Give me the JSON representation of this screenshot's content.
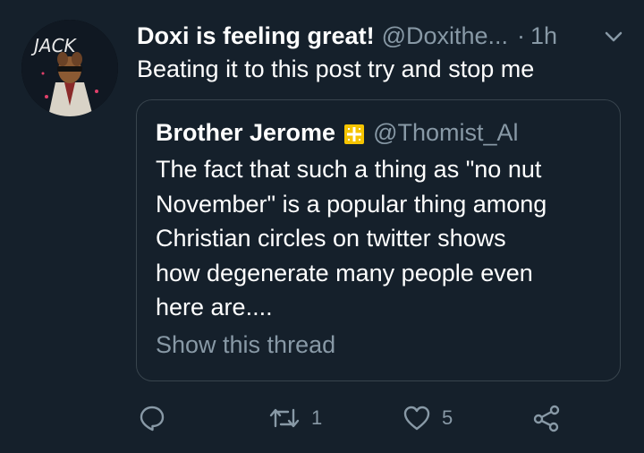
{
  "tweet": {
    "display_name": "Doxi is feeling great!",
    "handle": "@Doxithe...",
    "separator": "·",
    "time": "1h",
    "text": "Beating it to this post try and stop me",
    "avatar_text": "JACK"
  },
  "quoted_tweet": {
    "display_name": "Brother Jerome",
    "handle": "@Thomist_Al",
    "lines": [
      "The fact that such a thing as \"no nut",
      "November\" is a popular thing among",
      "Christian circles on twitter shows",
      "how degenerate many people even",
      "here are...."
    ],
    "show_thread": "Show this thread"
  },
  "actions": {
    "retweet_count": "1",
    "like_count": "5"
  },
  "icons": {
    "caret": "chevron-down-icon",
    "reply": "reply-icon",
    "retweet": "retweet-icon",
    "like": "heart-icon",
    "share": "share-icon",
    "flag": "jerusalem-cross-flag-icon"
  },
  "colors": {
    "background": "#15202b",
    "text": "#ffffff",
    "secondary": "#8899a6",
    "border": "#38444d",
    "flag_gold": "#f5c400"
  }
}
